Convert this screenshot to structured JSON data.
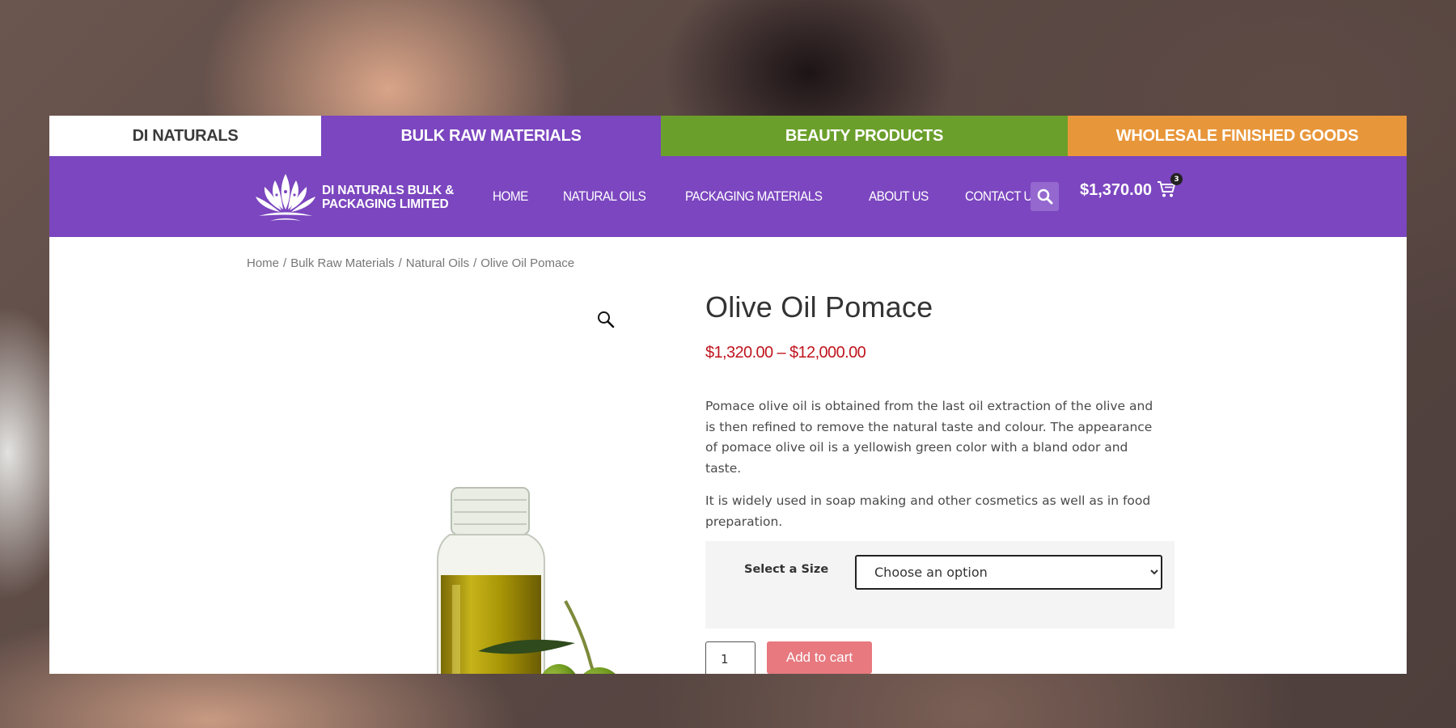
{
  "top_tabs": [
    {
      "label": "DI NATURALS"
    },
    {
      "label": "BULK RAW MATERIALS"
    },
    {
      "label": "BEAUTY PRODUCTS"
    },
    {
      "label": "WHOLESALE FINISHED GOODS"
    }
  ],
  "header": {
    "logo_line1": "DI NATURALS BULK &",
    "logo_line2": "PACKAGING LIMITED",
    "nav": [
      {
        "label": "HOME"
      },
      {
        "label": "NATURAL OILS"
      },
      {
        "label": "PACKAGING MATERIALS"
      },
      {
        "label": "ABOUT US"
      },
      {
        "label": "CONTACT US"
      }
    ],
    "cart_amount": "$1,370.00",
    "cart_count": "3",
    "search_icon": "search-icon",
    "cart_icon": "shopping-cart-icon"
  },
  "breadcrumb": {
    "items": [
      "Home",
      "Bulk Raw Materials",
      "Natural Oils"
    ],
    "current": "Olive Oil Pomace",
    "separator": "/"
  },
  "product": {
    "title": "Olive Oil Pomace",
    "price": "$1,320.00 – $12,000.00",
    "description": [
      "Pomace olive oil is obtained from the last oil extraction of the olive and is then refined to remove the natural taste and colour. The appearance of pomace olive oil is a yellowish green color with a bland odor and taste.",
      "It is widely used in soap making and other cosmetics as well as in food preparation."
    ],
    "variation_label": "Select a Size",
    "variation_selected": "Choose an option",
    "quantity": "1",
    "add_to_cart_label": "Add to cart",
    "zoom_icon": "magnifier-icon"
  },
  "colors": {
    "purple": "#7b46bf",
    "green": "#6b9f2b",
    "orange": "#e8963a",
    "price_red": "#c0161f",
    "button_pink": "#e7797f"
  }
}
